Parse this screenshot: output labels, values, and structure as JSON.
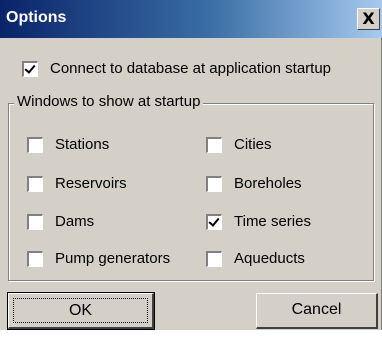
{
  "window": {
    "title": "Options",
    "close_label": "X"
  },
  "connect_option": {
    "label": "Connect to database at application startup",
    "checked": true
  },
  "startup_group": {
    "legend": "Windows to show at startup",
    "items": [
      {
        "label": "Stations",
        "checked": false
      },
      {
        "label": "Cities",
        "checked": false
      },
      {
        "label": "Reservoirs",
        "checked": false
      },
      {
        "label": "Boreholes",
        "checked": false
      },
      {
        "label": "Dams",
        "checked": false
      },
      {
        "label": "Time series",
        "checked": true
      },
      {
        "label": "Pump generators",
        "checked": false
      },
      {
        "label": "Aqueducts",
        "checked": false
      }
    ]
  },
  "buttons": {
    "ok_label": "OK",
    "cancel_label": "Cancel"
  },
  "colors": {
    "titlebar_start": "#0a246a",
    "titlebar_end": "#a6caf0",
    "dialog_face": "#d4d0c8"
  }
}
